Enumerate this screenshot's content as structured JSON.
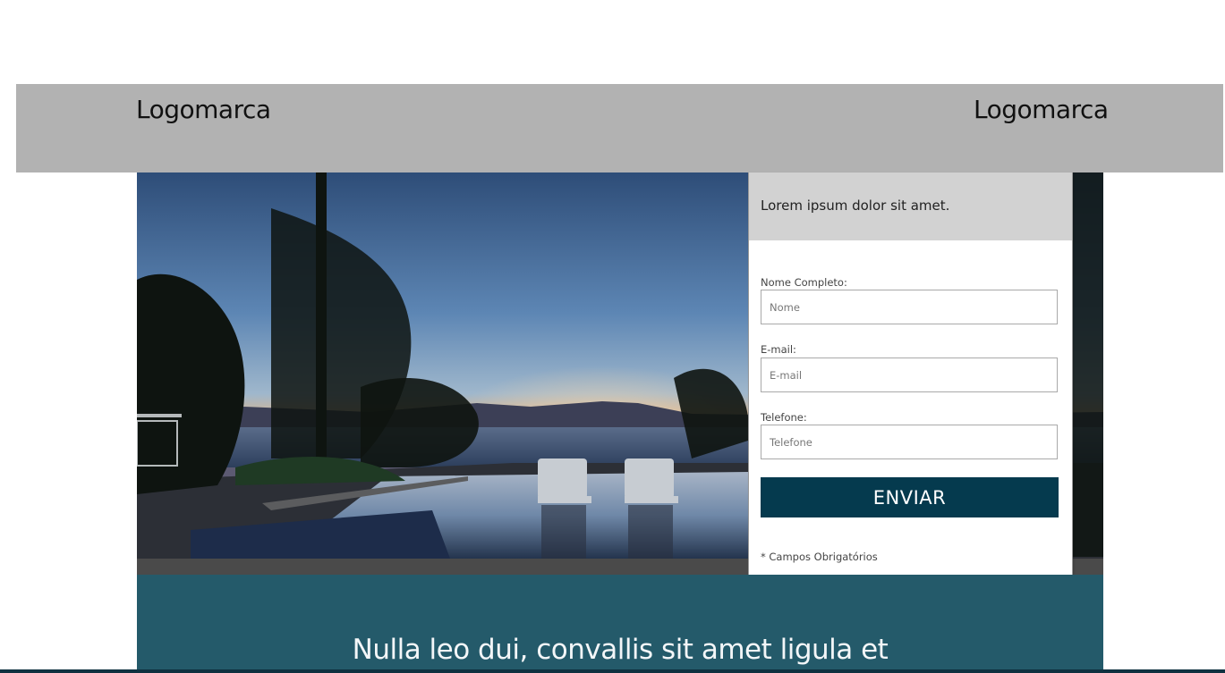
{
  "header": {
    "logo_left": "Logomarca",
    "logo_right": "Logomarca",
    "background": "#b2b2b2"
  },
  "hero": {
    "image_description_icon": "sunset-pool-photo"
  },
  "form": {
    "heading": "Lorem ipsum dolor sit amet.",
    "fields": [
      {
        "label": "Nome Completo:",
        "placeholder": "Nome"
      },
      {
        "label": "E-mail:",
        "placeholder": "E-mail"
      },
      {
        "label": "Telefone:",
        "placeholder": "Telefone"
      }
    ],
    "submit_label": "ENVIAR",
    "required_note": "* Campos Obrigatórios",
    "button_color": "#053a4e"
  },
  "band": {
    "title": "Nulla leo dui, convallis sit amet ligula et",
    "background": "#245a6a"
  }
}
